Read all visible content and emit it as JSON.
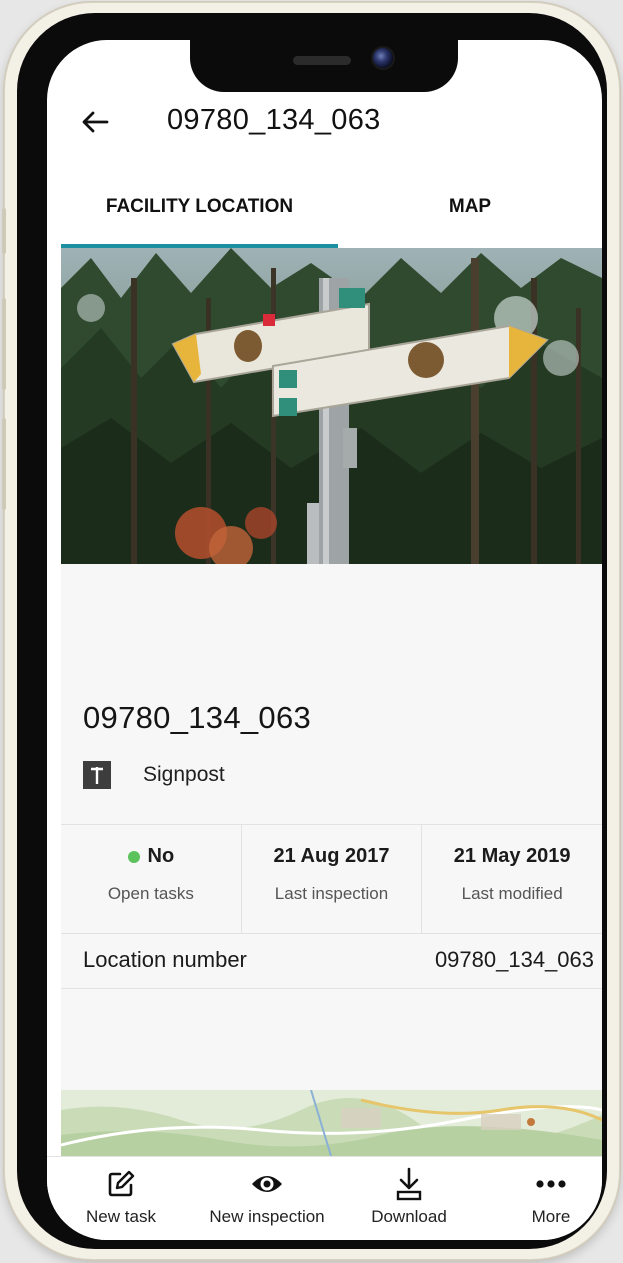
{
  "header": {
    "title": "09780_134_063"
  },
  "tabs": [
    {
      "label": "FACILITY LOCATION",
      "active": true
    },
    {
      "label": "MAP",
      "active": false
    }
  ],
  "facility": {
    "name": "09780_134_063",
    "type": "Signpost",
    "type_icon": "signpost-icon"
  },
  "stats": [
    {
      "value": "No",
      "label": "Open tasks",
      "status_color": "#5cc25c"
    },
    {
      "value": "21 Aug 2017",
      "label": "Last inspection"
    },
    {
      "value": "21 May 2019",
      "label": "Last modified"
    }
  ],
  "location": {
    "label": "Location number",
    "value": "09780_134_063"
  },
  "bottom_nav": [
    {
      "label": "New task",
      "icon": "edit-icon"
    },
    {
      "label": "New inspection",
      "icon": "eye-icon"
    },
    {
      "label": "Download",
      "icon": "download-icon"
    },
    {
      "label": "More",
      "icon": "more-icon"
    }
  ],
  "colors": {
    "accent": "#1c8fa0",
    "status_green": "#5cc25c"
  }
}
